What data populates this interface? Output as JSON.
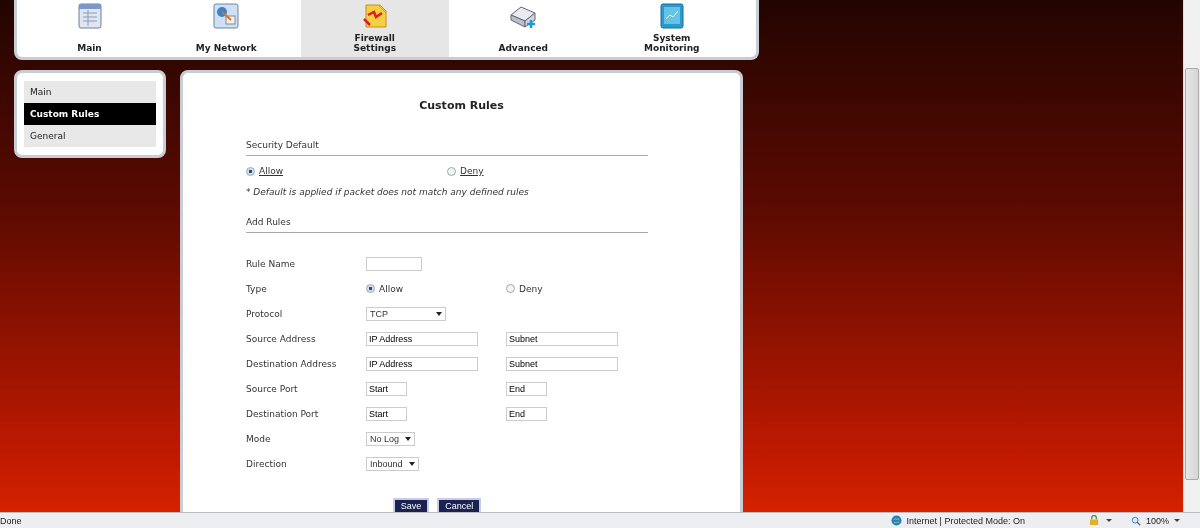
{
  "nav_tabs": [
    {
      "label": "Main",
      "selected": false
    },
    {
      "label": "My Network",
      "selected": false
    },
    {
      "label": "Firewall Settings",
      "selected": true
    },
    {
      "label": "Advanced",
      "selected": false
    },
    {
      "label": "System Monitoring",
      "selected": false
    }
  ],
  "sidebar": {
    "items": [
      {
        "label": "Main",
        "selected": false
      },
      {
        "label": "Custom Rules",
        "selected": true
      },
      {
        "label": "General",
        "selected": false
      }
    ]
  },
  "content": {
    "title": "Custom Rules",
    "security_default": {
      "heading": "Security Default",
      "options": [
        {
          "label": "Allow",
          "selected": true
        },
        {
          "label": "Deny",
          "selected": false
        }
      ],
      "note": "* Default is applied if packet does not match any defined rules"
    },
    "add_rules": {
      "heading": "Add Rules",
      "fields": [
        {
          "kind": "text",
          "label": "Rule Name"
        },
        {
          "kind": "radio",
          "label": "Type",
          "options": [
            {
              "label": "Allow",
              "selected": true
            },
            {
              "label": "Deny",
              "selected": false
            }
          ]
        },
        {
          "kind": "select",
          "label": "Protocol",
          "value": "TCP"
        },
        {
          "kind": "address",
          "label": "Source Address",
          "values": [
            "IP Address",
            "Subnet"
          ]
        },
        {
          "kind": "address",
          "label": "Destination Address",
          "values": [
            "IP Address",
            "Subnet"
          ]
        },
        {
          "kind": "port",
          "label": "Source Port",
          "values": [
            "Start",
            "End"
          ]
        },
        {
          "kind": "port",
          "label": "Destination Port",
          "values": [
            "Start",
            "End"
          ]
        },
        {
          "kind": "select",
          "label": "Mode",
          "value": "No Log"
        },
        {
          "kind": "select",
          "label": "Direction",
          "value": "Inbound"
        }
      ]
    },
    "buttons": [
      "Save",
      "Cancel"
    ]
  },
  "status_bar": {
    "status": "Done",
    "zone": "Internet | Protected Mode: On",
    "zoom": "100%"
  }
}
